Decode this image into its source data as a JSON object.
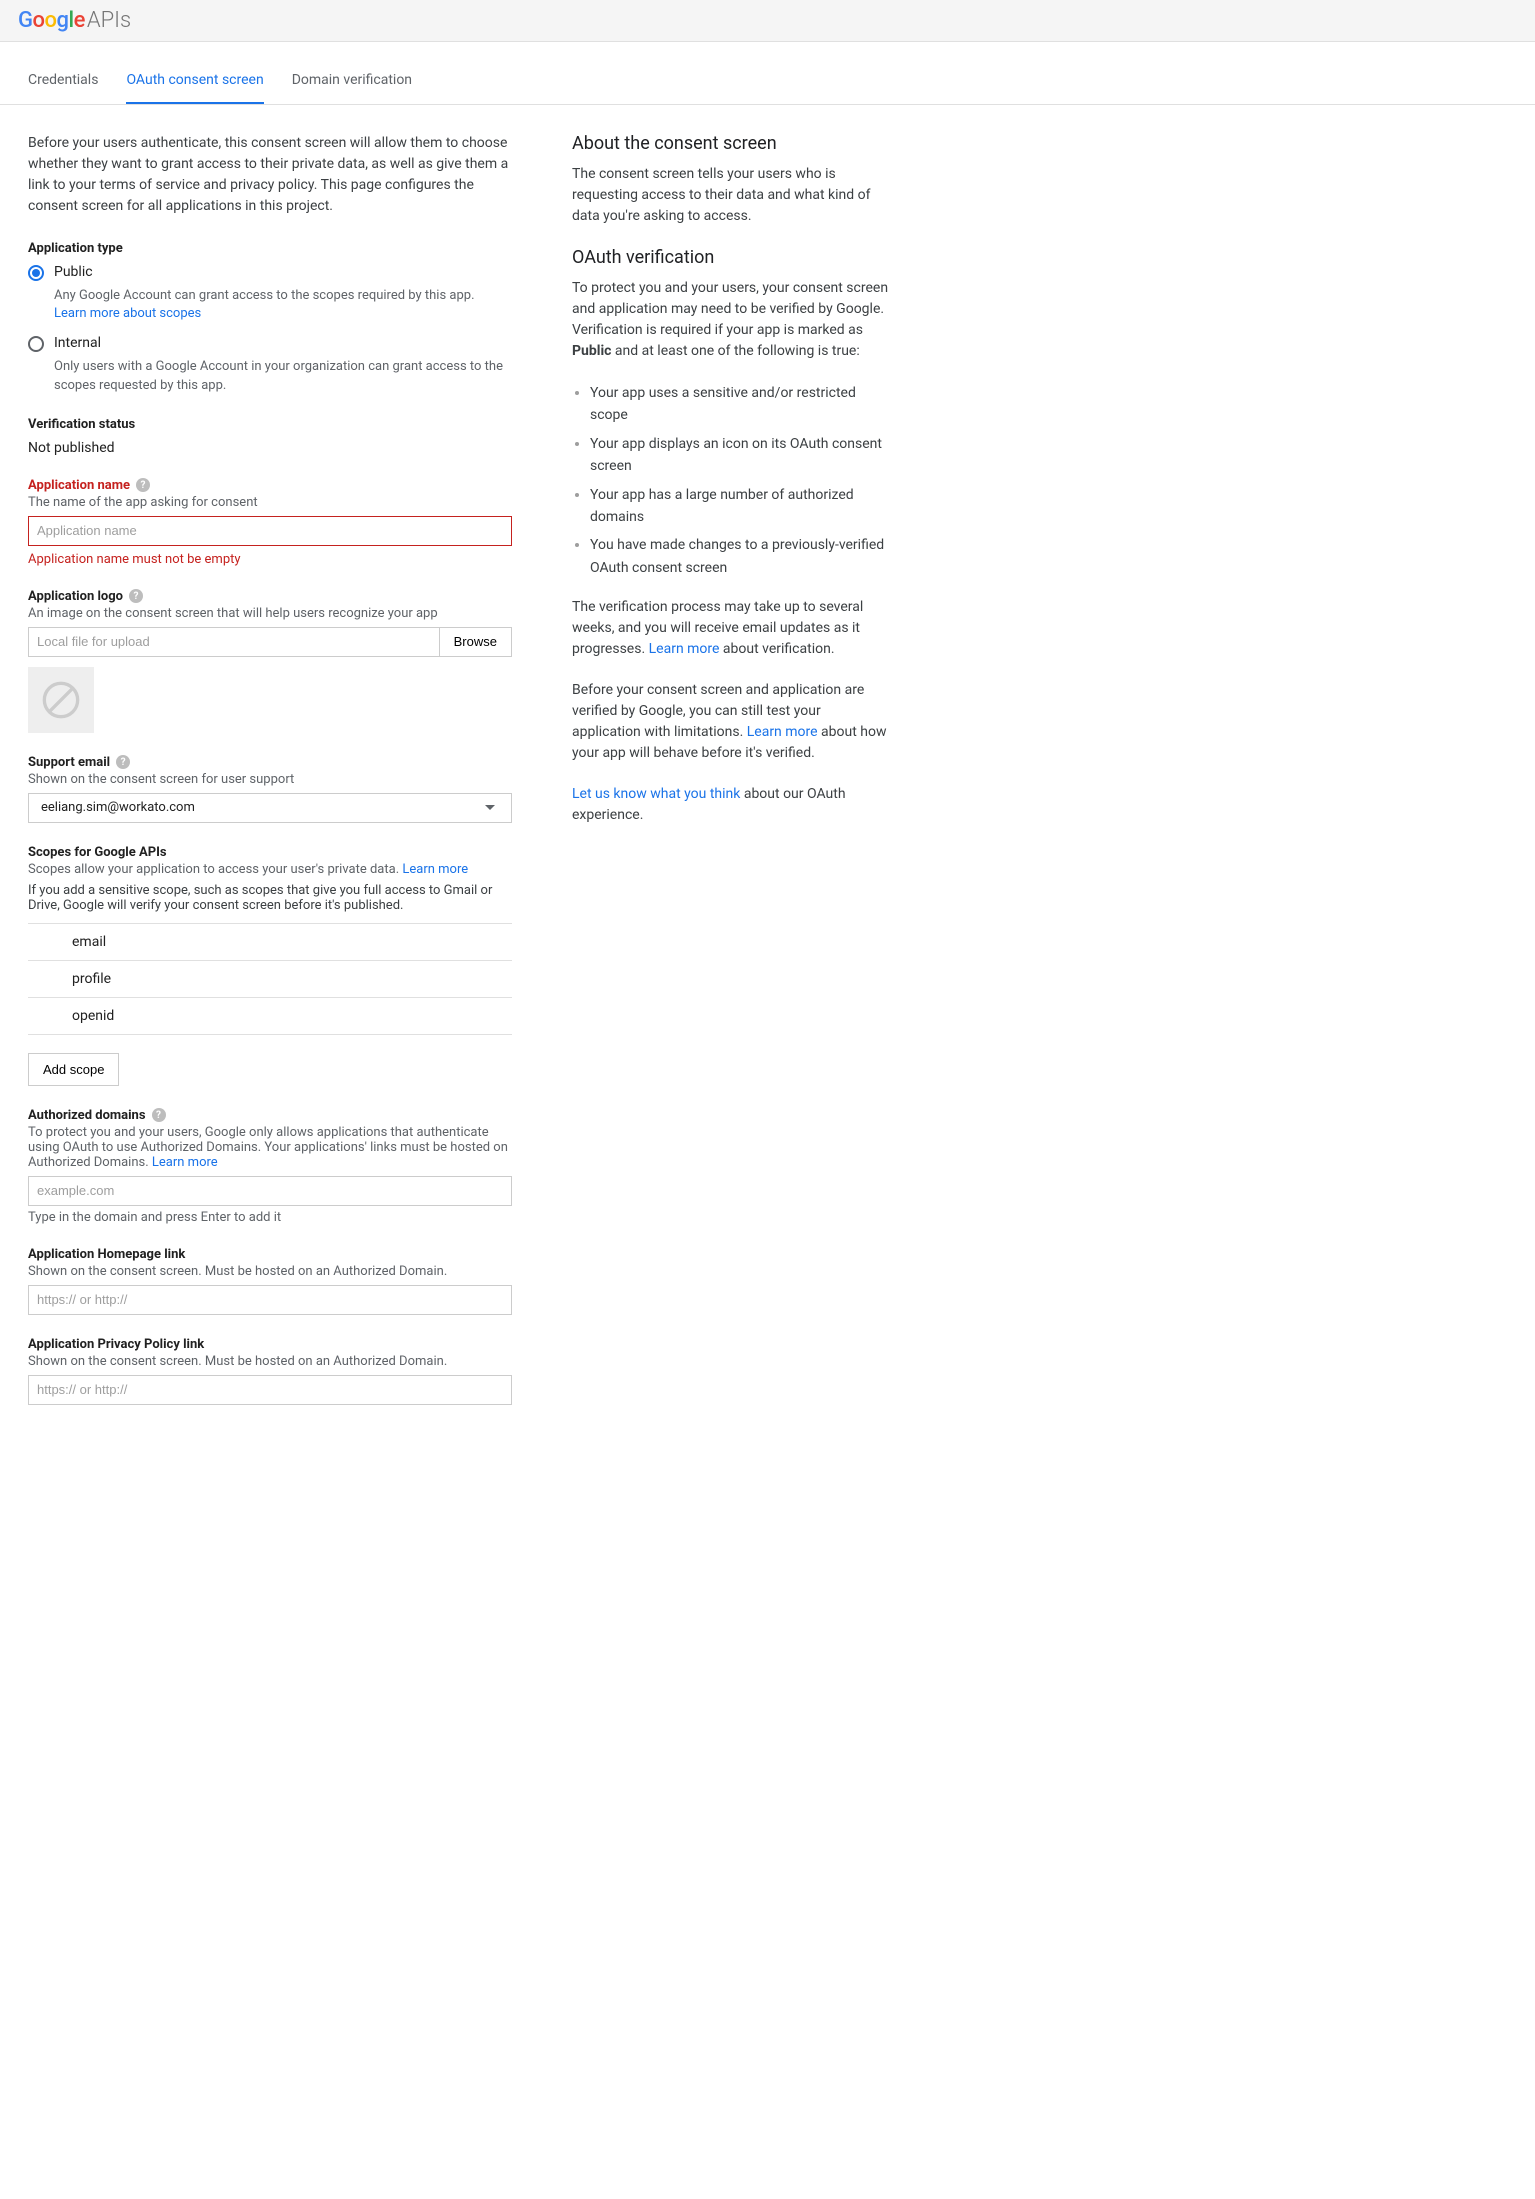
{
  "header": {
    "brand_suffix": "APIs"
  },
  "tabs": [
    {
      "label": "Credentials",
      "active": false
    },
    {
      "label": "OAuth consent screen",
      "active": true
    },
    {
      "label": "Domain verification",
      "active": false
    }
  ],
  "intro": "Before your users authenticate, this consent screen will allow them to choose whether they want to grant access to their private data, as well as give them a link to your terms of service and privacy policy. This page configures the consent screen for all applications in this project.",
  "application_type": {
    "title": "Application type",
    "public": {
      "label": "Public",
      "desc": "Any Google Account can grant access to the scopes required by this app.",
      "learn_more": "Learn more about scopes"
    },
    "internal": {
      "label": "Internal",
      "desc": "Only users with a Google Account in your organization can grant access to the scopes requested by this app."
    }
  },
  "verification_status": {
    "title": "Verification status",
    "value": "Not published"
  },
  "app_name": {
    "label": "Application name",
    "desc": "The name of the app asking for consent",
    "placeholder": "Application name",
    "value": "",
    "error": "Application name must not be empty"
  },
  "app_logo": {
    "label": "Application logo",
    "desc": "An image on the consent screen that will help users recognize your app",
    "placeholder": "Local file for upload",
    "browse": "Browse"
  },
  "support_email": {
    "label": "Support email",
    "desc": "Shown on the consent screen for user support",
    "value": "eeliang.sim@workato.com"
  },
  "scopes": {
    "label": "Scopes for Google APIs",
    "desc_1": "Scopes allow your application to access your user's private data. ",
    "learn_more": "Learn more",
    "desc_2": "If you add a sensitive scope, such as scopes that give you full access to Gmail or Drive, Google will verify your consent screen before it's published.",
    "items": [
      "email",
      "profile",
      "openid"
    ],
    "add_btn": "Add scope"
  },
  "authorized_domains": {
    "label": "Authorized domains",
    "desc_1": "To protect you and your users, Google only allows applications that authenticate using OAuth to use Authorized Domains. Your applications' links must be hosted on Authorized Domains. ",
    "learn_more": "Learn more",
    "placeholder": "example.com",
    "hint": "Type in the domain and press Enter to add it"
  },
  "homepage_link": {
    "label": "Application Homepage link",
    "desc": "Shown on the consent screen. Must be hosted on an Authorized Domain.",
    "placeholder": "https:// or http://"
  },
  "privacy_link": {
    "label": "Application Privacy Policy link",
    "desc": "Shown on the consent screen. Must be hosted on an Authorized Domain.",
    "placeholder": "https:// or http://"
  },
  "side": {
    "about_title": "About the consent screen",
    "about_text": "The consent screen tells your users who is requesting access to their data and what kind of data you're asking to access.",
    "verify_title": "OAuth verification",
    "verify_intro_1": "To protect you and your users, your consent screen and application may need to be verified by Google. Verification is required if your app is marked as ",
    "verify_intro_bold": "Public",
    "verify_intro_2": " and at least one of the following is true:",
    "bullets": [
      "Your app uses a sensitive and/or restricted scope",
      "Your app displays an icon on its OAuth consent screen",
      "Your app has a large number of authorized domains",
      "You have made changes to a previously-verified OAuth consent screen"
    ],
    "p2_a": "The verification process may take up to several weeks, and you will receive email updates as it progresses. ",
    "p2_link": "Learn more",
    "p2_b": " about verification.",
    "p3_a": "Before your consent screen and application are verified by Google, you can still test your application with limitations. ",
    "p3_link": "Learn more",
    "p3_b": " about how your app will behave before it's verified.",
    "p4_link": "Let us know what you think",
    "p4_b": " about our OAuth experience."
  }
}
